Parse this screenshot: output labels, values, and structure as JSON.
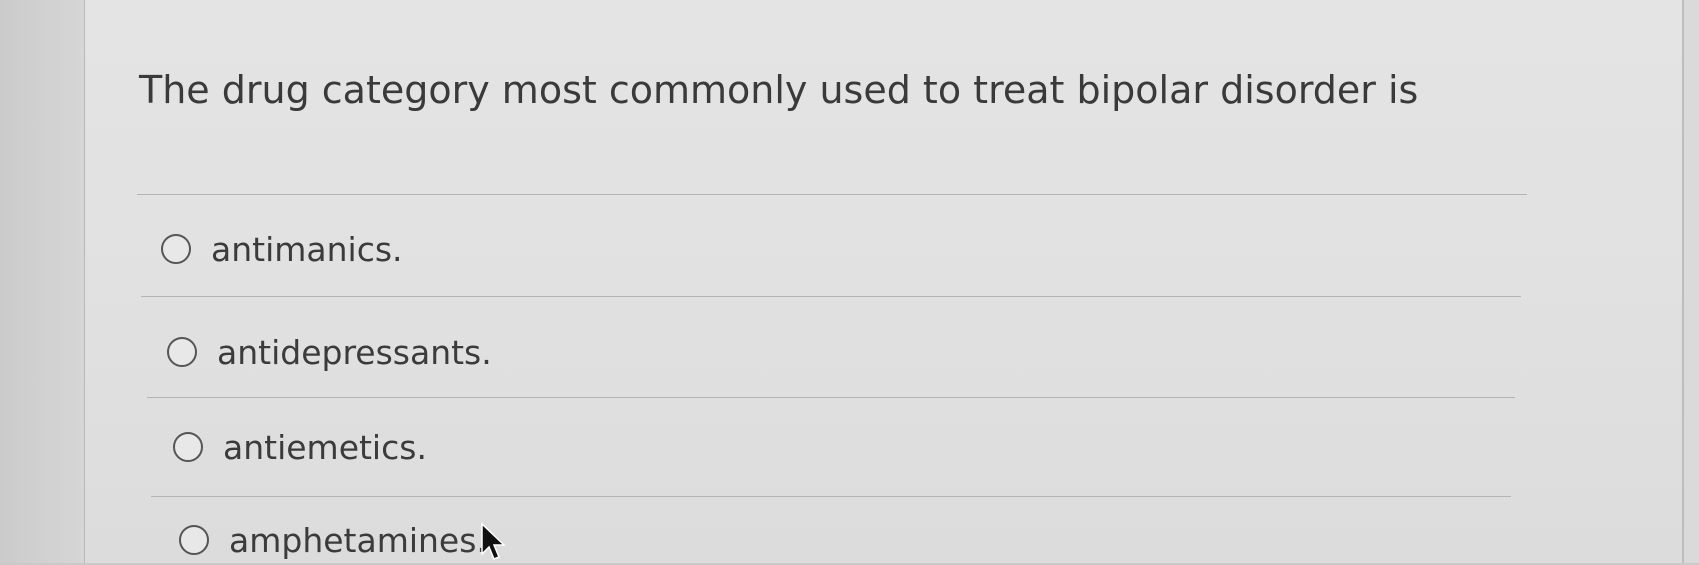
{
  "question": {
    "text": "The drug category most commonly used to treat bipolar disorder is"
  },
  "options": [
    {
      "label": "antimanics.",
      "selected": false
    },
    {
      "label": "antidepressants.",
      "selected": false
    },
    {
      "label": "antiemetics.",
      "selected": false
    },
    {
      "label": "amphetamines.",
      "selected": false
    }
  ],
  "icons": {
    "radio": "radio-button-unselected-icon",
    "cursor": "mouse-pointer-icon"
  }
}
